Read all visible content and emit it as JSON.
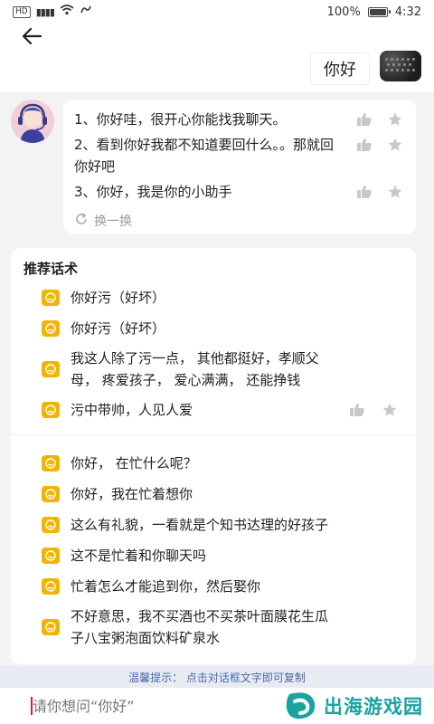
{
  "status_bar": {
    "network_badge": "HD",
    "signal_text": "⁴ᴳ",
    "battery_percent": "100%",
    "battery_level": 1.0,
    "time": "4:32"
  },
  "user_message": {
    "text": "你好"
  },
  "bot_reply": {
    "answers": [
      {
        "text": "1、你好哇，很开心你能找我聊天。"
      },
      {
        "text": "2、看到你好我都不知道要回什么。。那就回你好吧"
      },
      {
        "text": "3、你好，我是你的小助手"
      }
    ],
    "refresh_label": "换一换"
  },
  "recommend": {
    "title": "推荐话术",
    "groups": [
      {
        "items": [
          "你好污（好坏）",
          "你好污（好坏）",
          "我这人除了污一点，  其他都挺好，孝顺父母，  疼爱孩子，  爱心满满，  还能挣钱",
          "污中带帅，人见人爱"
        ]
      },
      {
        "items": [
          "你好，  在忙什么呢？",
          "你好，我在忙着想你",
          "这么有礼貌，一看就是个知书达理的好孩子",
          "这不是忙着和你聊天吗",
          "忙着怎么才能追到你，然后娶你",
          "不好意思，我不买酒也不买茶叶面膜花生瓜子八宝粥泡面饮料矿泉水"
        ]
      }
    ]
  },
  "tip": {
    "text": "温馨提示：  点击对话框文字即可复制"
  },
  "input": {
    "placeholder": "请你想问“你好”"
  },
  "watermark": {
    "text": "出海游戏园"
  },
  "colors": {
    "accent_yellow": "#f2b400",
    "watermark_teal": "#1aa3a0",
    "tip_blue": "#4a6aa8"
  }
}
